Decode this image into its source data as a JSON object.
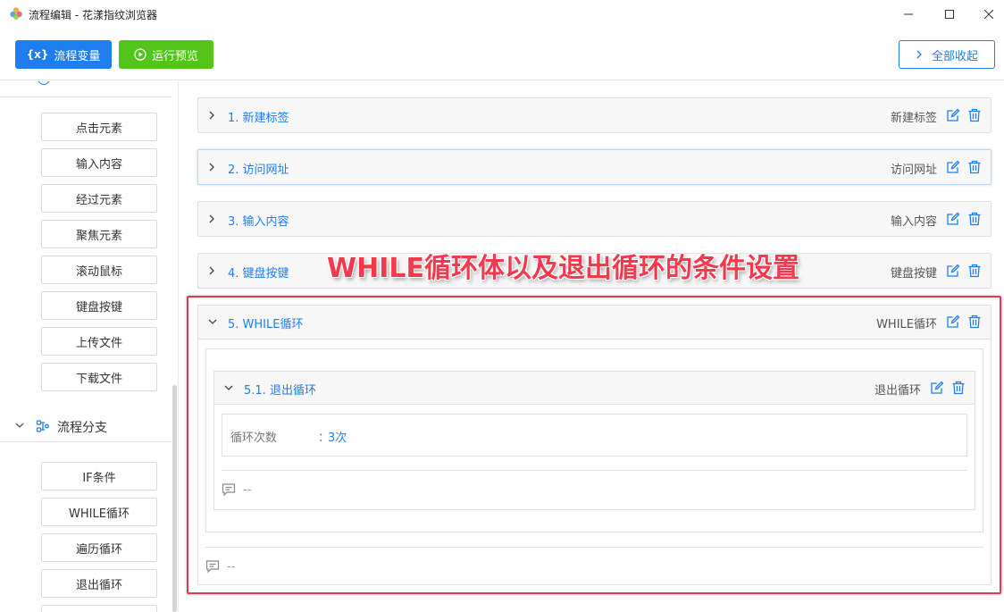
{
  "window": {
    "title": "流程编辑 - 花漾指纹浏览器"
  },
  "toolbar": {
    "vars_icon": "{x}",
    "vars_label": "流程变量",
    "run_label": "运行预览",
    "collapse_label": "全部收起"
  },
  "sidebar": {
    "actions": [
      "点击元素",
      "输入内容",
      "经过元素",
      "聚焦元素",
      "滚动鼠标",
      "键盘按键",
      "上传文件",
      "下载文件"
    ],
    "branch_group": {
      "label": "流程分支",
      "items": [
        "IF条件",
        "WHILE循环",
        "遍历循环",
        "退出循环"
      ]
    }
  },
  "steps": [
    {
      "title": "1. 新建标签",
      "type": "新建标签"
    },
    {
      "title": "2. 访问网址",
      "type": "访问网址"
    },
    {
      "title": "3. 输入内容",
      "type": "输入内容"
    },
    {
      "title": "4. 键盘按键",
      "type": "键盘按键"
    }
  ],
  "while_step": {
    "title": "5. WHILE循环",
    "type": "WHILE循环",
    "comment": "--",
    "child": {
      "title": "5.1. 退出循环",
      "type": "退出循环",
      "param_label": "循环次数",
      "param_colon": "：",
      "param_value": "3次",
      "comment": "--"
    }
  },
  "annotation": {
    "text": "WHILE循环体以及退出循环的条件设置",
    "color": "#f23a4e"
  },
  "colors": {
    "primary": "#1e7ef0",
    "success": "#52c41a"
  }
}
